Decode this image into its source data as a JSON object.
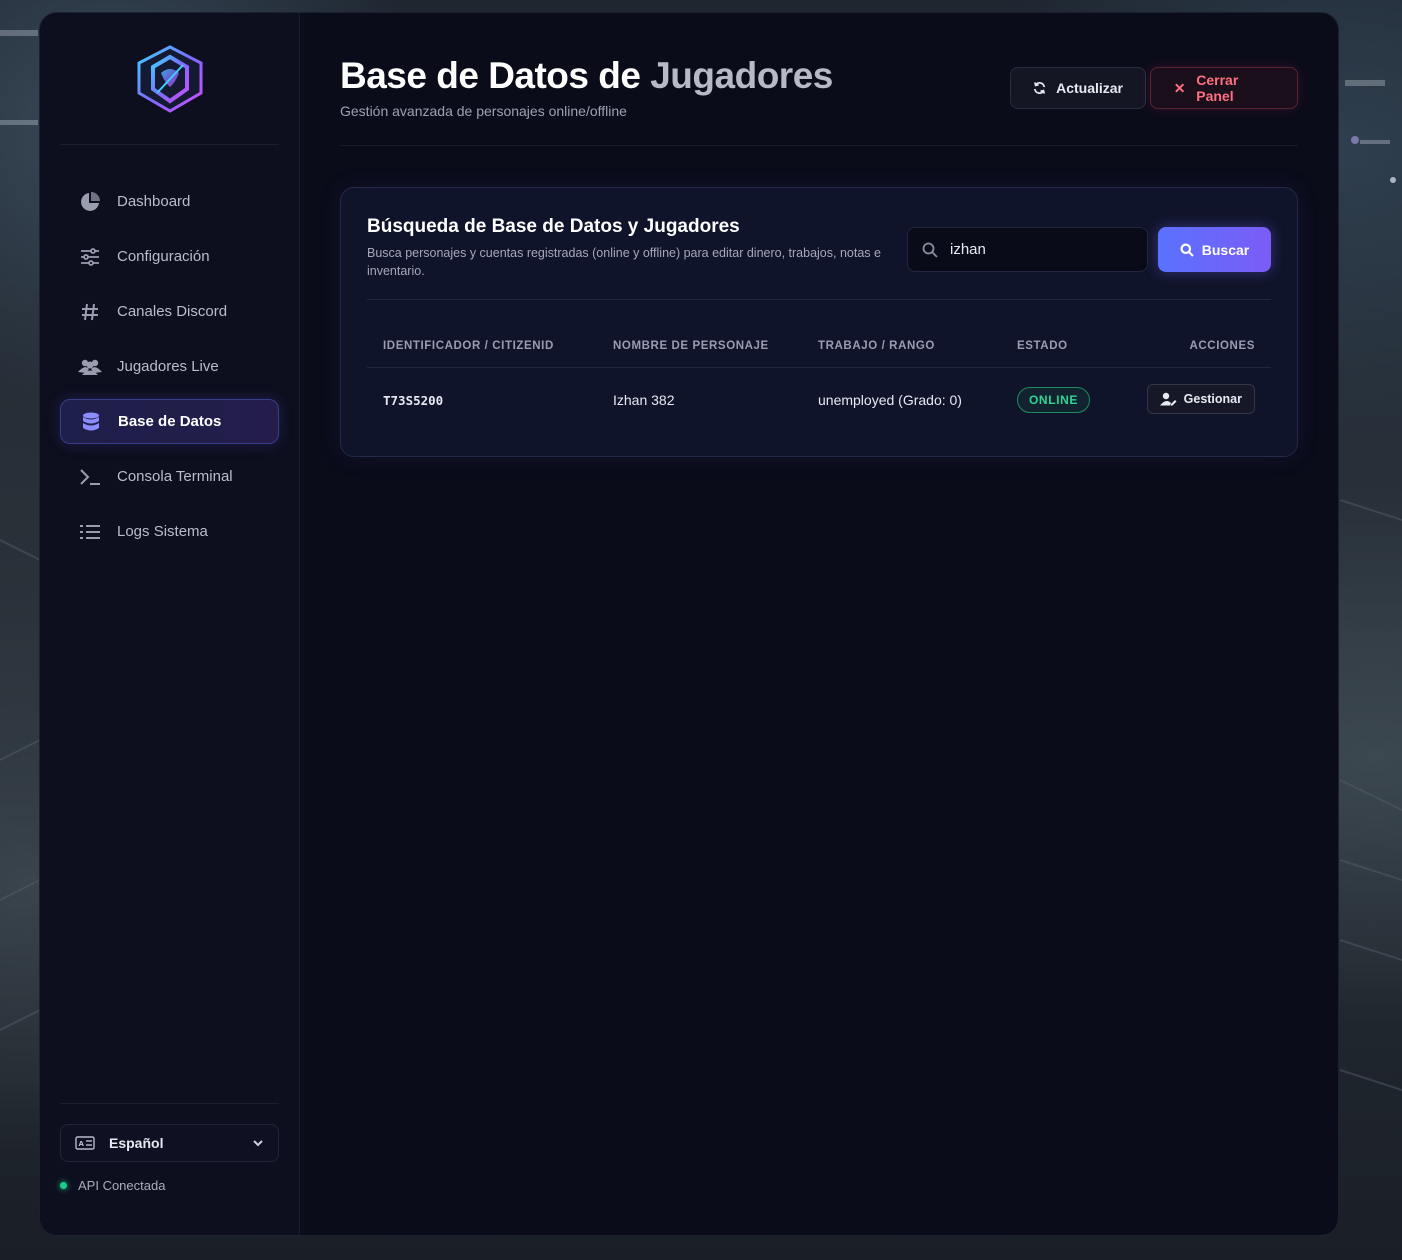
{
  "sidebar": {
    "logo": "crest-logo",
    "items": [
      {
        "label": "Dashboard",
        "icon": "pie-chart-icon",
        "active": false
      },
      {
        "label": "Configuración",
        "icon": "sliders-icon",
        "active": false
      },
      {
        "label": "Canales Discord",
        "icon": "hash-icon",
        "active": false
      },
      {
        "label": "Jugadores Live",
        "icon": "users-icon",
        "active": false
      },
      {
        "label": "Base de Datos",
        "icon": "database-icon",
        "active": true
      },
      {
        "label": "Consola Terminal",
        "icon": "terminal-icon",
        "active": false
      },
      {
        "label": "Logs Sistema",
        "icon": "list-icon",
        "active": false
      }
    ],
    "language": {
      "selected": "Español",
      "icon": "language-icon"
    },
    "api_status": {
      "label": "API Conectada",
      "color": "#1fc98a"
    }
  },
  "header": {
    "title_part1": "Base de Datos de ",
    "title_part2": "Jugadores",
    "subtitle": "Gestión avanzada de personajes online/offline",
    "refresh_label": "Actualizar",
    "close_label": "Cerrar Panel"
  },
  "search_card": {
    "title": "Búsqueda de Base de Datos y Jugadores",
    "description": "Busca personajes y cuentas registradas (online y offline) para editar dinero, trabajos, notas e inventario.",
    "search_value": "izhan",
    "search_button": "Buscar"
  },
  "table": {
    "columns": [
      "IDENTIFICADOR / CITIZENID",
      "NOMBRE DE PERSONAJE",
      "TRABAJO / RANGO",
      "ESTADO",
      "ACCIONES"
    ],
    "rows": [
      {
        "citizenid": "T73S5200",
        "name": "Izhan 382",
        "job": "unemployed (Grado: 0)",
        "status": "ONLINE",
        "action": "Gestionar"
      }
    ]
  },
  "colors": {
    "accent": "#5a72ff",
    "accent2": "#7b5cf6",
    "online": "#2fd495",
    "danger": "#ff6f80",
    "panel_bg": "#0b0c1a"
  }
}
